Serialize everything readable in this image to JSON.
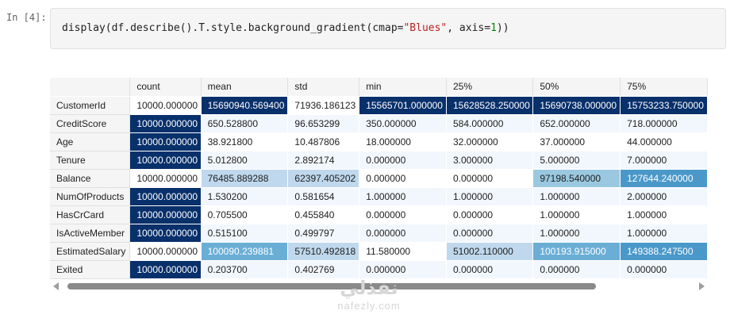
{
  "cell": {
    "prompt": "In [4]:",
    "code": {
      "p1": "display(df.describe().",
      "p2": "T",
      "p3": ".style.background_gradient(cmap=",
      "str": "\"Blues\"",
      "p4": ", axis=",
      "num": "1",
      "p5": "))"
    }
  },
  "table": {
    "columns": [
      "",
      "count",
      "mean",
      "std",
      "min",
      "25%",
      "50%",
      "75%"
    ],
    "rows": [
      {
        "name": "CustomerId",
        "cells": [
          "10000.000000",
          "15690940.569400",
          "71936.186123",
          "15565701.000000",
          "15628528.250000",
          "15690738.000000",
          "15753233.750000"
        ],
        "shade": [
          "lo",
          "hi",
          "lo",
          "hi",
          "hi",
          "hi",
          "hi"
        ]
      },
      {
        "name": "CreditScore",
        "cells": [
          "10000.000000",
          "650.528800",
          "96.653299",
          "350.000000",
          "584.000000",
          "652.000000",
          "718.000000"
        ],
        "shade": [
          "hi",
          "lo",
          "lo",
          "lo",
          "lo",
          "lo",
          "lo"
        ]
      },
      {
        "name": "Age",
        "cells": [
          "10000.000000",
          "38.921800",
          "10.487806",
          "18.000000",
          "32.000000",
          "37.000000",
          "44.000000"
        ],
        "shade": [
          "hi",
          "lo",
          "lo",
          "lo",
          "lo",
          "lo",
          "lo"
        ]
      },
      {
        "name": "Tenure",
        "cells": [
          "10000.000000",
          "5.012800",
          "2.892174",
          "0.000000",
          "3.000000",
          "5.000000",
          "7.000000"
        ],
        "shade": [
          "hi",
          "lo",
          "lo",
          "lo",
          "lo",
          "lo",
          "lo"
        ]
      },
      {
        "name": "Balance",
        "cells": [
          "10000.000000",
          "76485.889288",
          "62397.405202",
          "0.000000",
          "0.000000",
          "97198.540000",
          "127644.240000"
        ],
        "shade": [
          "lo",
          "l2",
          "l2",
          "lo",
          "lo",
          "mid",
          "m3"
        ]
      },
      {
        "name": "NumOfProducts",
        "cells": [
          "10000.000000",
          "1.530200",
          "0.581654",
          "1.000000",
          "1.000000",
          "1.000000",
          "2.000000"
        ],
        "shade": [
          "hi",
          "lo",
          "lo",
          "lo",
          "lo",
          "lo",
          "lo"
        ]
      },
      {
        "name": "HasCrCard",
        "cells": [
          "10000.000000",
          "0.705500",
          "0.455840",
          "0.000000",
          "0.000000",
          "1.000000",
          "1.000000"
        ],
        "shade": [
          "hi",
          "lo",
          "lo",
          "lo",
          "lo",
          "lo",
          "lo"
        ]
      },
      {
        "name": "IsActiveMember",
        "cells": [
          "10000.000000",
          "0.515100",
          "0.499797",
          "0.000000",
          "0.000000",
          "1.000000",
          "1.000000"
        ],
        "shade": [
          "hi",
          "lo",
          "lo",
          "lo",
          "lo",
          "lo",
          "lo"
        ]
      },
      {
        "name": "EstimatedSalary",
        "cells": [
          "10000.000000",
          "100090.239881",
          "57510.492818",
          "11.580000",
          "51002.110000",
          "100193.915000",
          "149388.247500"
        ],
        "shade": [
          "lo",
          "m2",
          "l2",
          "lo",
          "l2",
          "m2",
          "m3"
        ]
      },
      {
        "name": "Exited",
        "cells": [
          "10000.000000",
          "0.203700",
          "0.402769",
          "0.000000",
          "0.000000",
          "0.000000",
          "0.000000"
        ],
        "shade": [
          "hi",
          "lo",
          "lo",
          "lo",
          "lo",
          "lo",
          "lo"
        ]
      }
    ]
  },
  "watermark": {
    "arabic": "نفذلي",
    "latin": "nafezly.com"
  },
  "colors": {
    "gradient_low": "#f7fbff",
    "gradient_high": "#08306b",
    "header_bg": "#f5f5f5"
  }
}
